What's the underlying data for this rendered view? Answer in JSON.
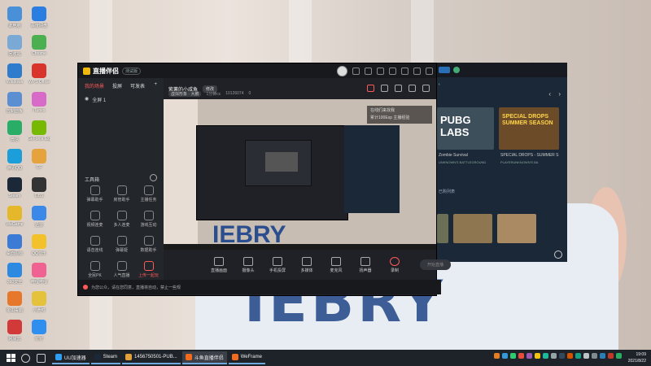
{
  "desktop": {
    "icons": [
      {
        "label": "此电脑",
        "color": "#4a90d9"
      },
      {
        "label": "回收站",
        "color": "#7aa9d6"
      },
      {
        "label": "Windows",
        "color": "#2f7ccd"
      },
      {
        "label": "控制面板",
        "color": "#5b8fd1"
      },
      {
        "label": "微信",
        "color": "#2aae67"
      },
      {
        "label": "腾讯QQ",
        "color": "#1b9ed9"
      },
      {
        "label": "Steam",
        "color": "#1b2838"
      },
      {
        "label": "WeGame",
        "color": "#e5b82b"
      },
      {
        "label": "桌面图标",
        "color": "#3b7bd6"
      },
      {
        "label": "360安全",
        "color": "#2d8ae0"
      },
      {
        "label": "金山毒霸",
        "color": "#e7782b"
      },
      {
        "label": "网易云",
        "color": "#d23a3a"
      },
      {
        "label": "百度网盘",
        "color": "#2a7de1"
      },
      {
        "label": "Chrome",
        "color": "#4caf50"
      },
      {
        "label": "WPS Office",
        "color": "#d9342b"
      },
      {
        "label": "iTunes",
        "color": "#d96bc8"
      },
      {
        "label": "GeForce Experience",
        "color": "#76b900"
      },
      {
        "label": "CF",
        "color": "#e6a23c"
      },
      {
        "label": "OBS",
        "color": "#333"
      },
      {
        "label": "迅雷",
        "color": "#3a88e8"
      },
      {
        "label": "QQ音乐",
        "color": "#f3c22b"
      },
      {
        "label": "哔哩哔哩",
        "color": "#f06292"
      },
      {
        "label": "小黄鸭",
        "color": "#e5c23c"
      },
      {
        "label": "钉钉",
        "color": "#2f8ff0"
      }
    ]
  },
  "app": {
    "name": "直播伴侣",
    "version": "测试版",
    "scene_tabs": [
      "我的场景",
      "投屏",
      "可发表"
    ],
    "scene_item": "全屏 1",
    "tools_title": "工具箱",
    "tools": [
      {
        "label": "弹幕助手",
        "active": false
      },
      {
        "label": "房管助手",
        "active": false
      },
      {
        "label": "主播任务",
        "active": false
      },
      {
        "label": "视频连麦",
        "active": false
      },
      {
        "label": "多人连麦",
        "active": false
      },
      {
        "label": "游戏互动",
        "active": false
      },
      {
        "label": "语音连线",
        "active": false
      },
      {
        "label": "弹幕姬",
        "active": false
      },
      {
        "label": "数据助手",
        "active": false
      },
      {
        "label": "全民PK",
        "active": false
      },
      {
        "label": "人气直播",
        "active": false
      },
      {
        "label": "上传一起玩",
        "active": true
      }
    ],
    "room_title": "紫薯的小咸鱼",
    "room_tag": "修改",
    "room_sub": [
      "虚拟形象 · 大鹏",
      "1分钟cc",
      "10126074",
      "0"
    ],
    "overlay": [
      "在线们来找我",
      "累计100Exp 主播经验"
    ],
    "bottom_buttons": [
      "直播画面",
      "摄像头",
      "手机投屏",
      "多媒体",
      "麦克风",
      "扬声器",
      "录制"
    ],
    "start_button": "开始直播",
    "status_text": "为您公众，请在您同意，直播将自动，禁止一些规"
  },
  "game_panel": {
    "cards": [
      "PUBG LABS",
      "SPECIAL DROPS SUMMER SEASON"
    ],
    "caption_left": "Zombie Survival",
    "caption_right": "SPECIAL DROPS - SUMMER S",
    "subcaption_left": "UNKNOWN'S BATTLEGROUND",
    "subcaption_right": "PLAYERUNKNOWN'S BA",
    "section_label": "已购列表"
  },
  "wallpaper": {
    "shirt_text": "IEBRY"
  },
  "taskbar": {
    "tasks": [
      {
        "label": "UU加速器",
        "color": "#2f9ef3",
        "active": false
      },
      {
        "label": "Steam",
        "color": "#1b2838",
        "active": false
      },
      {
        "label": "1456750501-PUB...",
        "color": "#e0a03a",
        "active": false
      },
      {
        "label": "斗鱼直播伴侣",
        "color": "#f26a1b",
        "active": true
      },
      {
        "label": "WeFrame",
        "color": "#f26a1b",
        "active": false
      }
    ],
    "time": "19:09",
    "date": "2021/8/22"
  }
}
